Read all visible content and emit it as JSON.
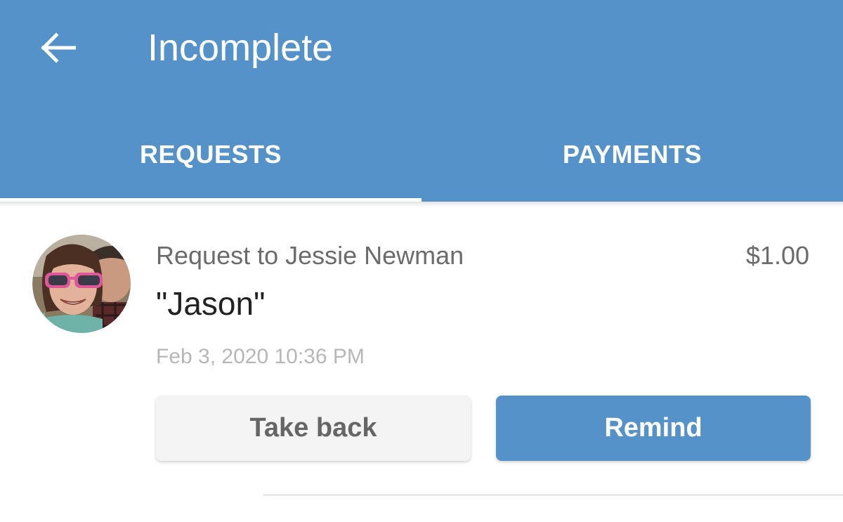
{
  "header": {
    "back_icon": "arrow-left-icon",
    "title": "Incomplete",
    "background_color": "#5592c9"
  },
  "tabs": [
    {
      "label": "REQUESTS",
      "selected": true
    },
    {
      "label": "PAYMENTS",
      "selected": false
    }
  ],
  "request": {
    "recipient_line": "Request to Jessie Newman",
    "amount": "$1.00",
    "note": "\"Jason\"",
    "timestamp": "Feb 3, 2020 10:36 PM",
    "avatar_icon": "user-photo-avatar"
  },
  "actions": {
    "take_back_label": "Take back",
    "remind_label": "Remind"
  },
  "colors": {
    "accent": "#5592c9",
    "secondary_button": "#f4f4f4"
  }
}
